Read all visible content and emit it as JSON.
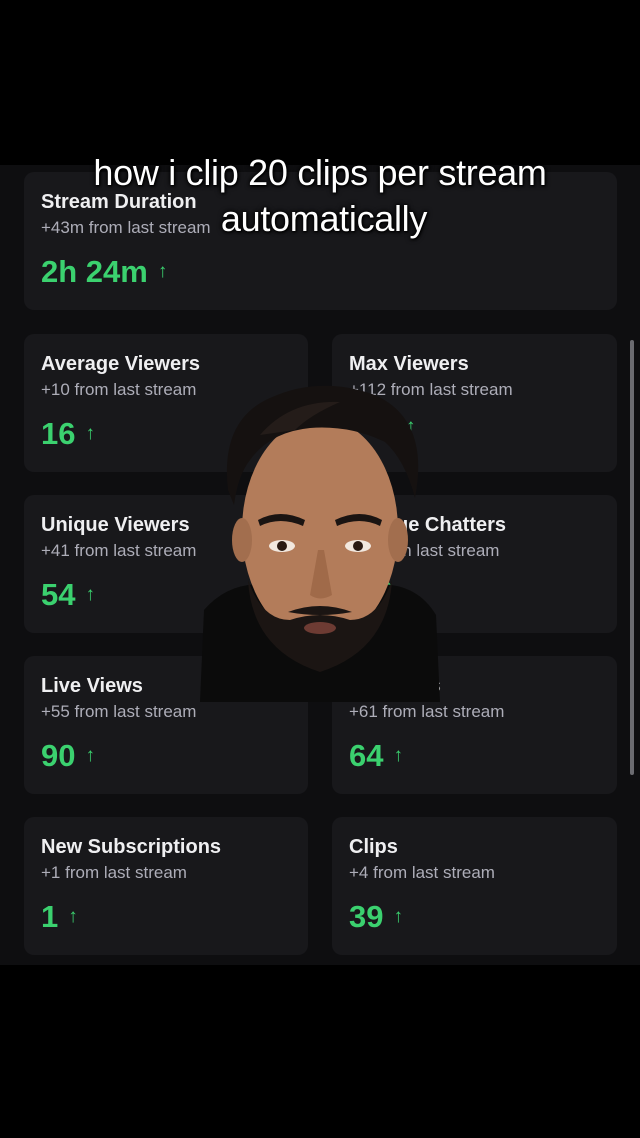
{
  "caption": {
    "line1": "how i clip 20 clips per stream",
    "line2": "automatically"
  },
  "stats": {
    "stream_duration": {
      "title": "Stream Duration",
      "sub": "+43m from last stream",
      "value": "2h 24m",
      "arrow": "↑"
    },
    "average_viewers": {
      "title": "Average Viewers",
      "sub": "+10 from last stream",
      "value": "16",
      "arrow": "↑"
    },
    "max_viewers": {
      "title": "Max Viewers",
      "sub": "+112 from last stream",
      "value": "",
      "arrow": "↑"
    },
    "unique_viewers": {
      "title": "Unique Viewers",
      "sub": "+41 from last stream",
      "value": "54",
      "arrow": "↑"
    },
    "unique_chatters": {
      "title": "ue Chatters",
      "sub": "om last stream",
      "value": "",
      "arrow": "↑"
    },
    "live_views": {
      "title": "Live Views",
      "sub": "+55 from last stream",
      "value": "90",
      "arrow": "↑"
    },
    "followers": {
      "title": "rs",
      "sub": "+61 from last stream",
      "value": "64",
      "arrow": "↑"
    },
    "new_subscriptions": {
      "title": "New Subscriptions",
      "sub": "+1 from last stream",
      "value": "1",
      "arrow": "↑"
    },
    "clips": {
      "title": "Clips",
      "sub": "+4 from last stream",
      "value": "39",
      "arrow": "↑"
    }
  },
  "colors": {
    "background": "#000000",
    "panel": "#0e0e10",
    "card": "#18181b",
    "positive": "#3bd16f",
    "muted_text": "#adadb8"
  }
}
